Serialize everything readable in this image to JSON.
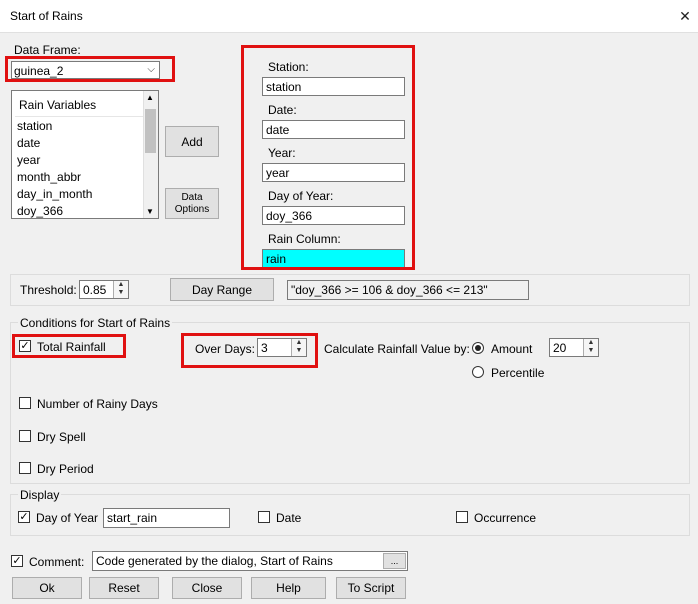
{
  "window": {
    "title": "Start of Rains"
  },
  "data_frame": {
    "label": "Data Frame:",
    "value": "guinea_2"
  },
  "rain_list": {
    "header": "Rain Variables",
    "items": [
      "station",
      "date",
      "year",
      "month_abbr",
      "day_in_month",
      "doy_366"
    ]
  },
  "buttons": {
    "add": "Add",
    "data_options_1": "Data",
    "data_options_2": "Options"
  },
  "fields": {
    "station": {
      "label": "Station:",
      "value": "station"
    },
    "date": {
      "label": "Date:",
      "value": "date"
    },
    "year": {
      "label": "Year:",
      "value": "year"
    },
    "doy": {
      "label": "Day of Year:",
      "value": "doy_366"
    },
    "rain": {
      "label": "Rain Column:",
      "value": "rain"
    }
  },
  "threshold": {
    "label": "Threshold:",
    "value": "0.85"
  },
  "day_range": {
    "button": "Day Range",
    "expression": "\"doy_366 >= 106 & doy_366 <= 213\""
  },
  "conditions": {
    "title": "Conditions for Start of Rains",
    "total_rainfall": {
      "label": "Total Rainfall",
      "checked": true
    },
    "over_days": {
      "label": "Over Days:",
      "value": "3"
    },
    "calc_label": "Calculate Rainfall Value by:",
    "amount": {
      "label": "Amount",
      "value": "20",
      "selected": true
    },
    "percentile": {
      "label": "Percentile",
      "selected": false
    },
    "rainy_days": {
      "label": "Number of Rainy Days",
      "checked": false
    },
    "dry_spell": {
      "label": "Dry Spell",
      "checked": false
    },
    "dry_period": {
      "label": "Dry Period",
      "checked": false
    }
  },
  "display": {
    "title": "Display",
    "day_of_year": {
      "label": "Day of Year",
      "checked": true,
      "value": "start_rain"
    },
    "date": {
      "label": "Date",
      "checked": false
    },
    "occurrence": {
      "label": "Occurrence",
      "checked": false
    }
  },
  "comment": {
    "label": "Comment:",
    "checked": true,
    "value": "Code generated by the dialog, Start of Rains",
    "ellipsis": "..."
  },
  "footer": {
    "ok": "Ok",
    "reset": "Reset",
    "close": "Close",
    "help": "Help",
    "script": "To Script"
  },
  "glyphs": {
    "close": "✕",
    "check": "✓",
    "down": "⌵",
    "up_small": "▲",
    "down_small": "▼"
  },
  "colors": {
    "highlight_red": "#e01010",
    "selected_cyan": "#00ffff"
  }
}
